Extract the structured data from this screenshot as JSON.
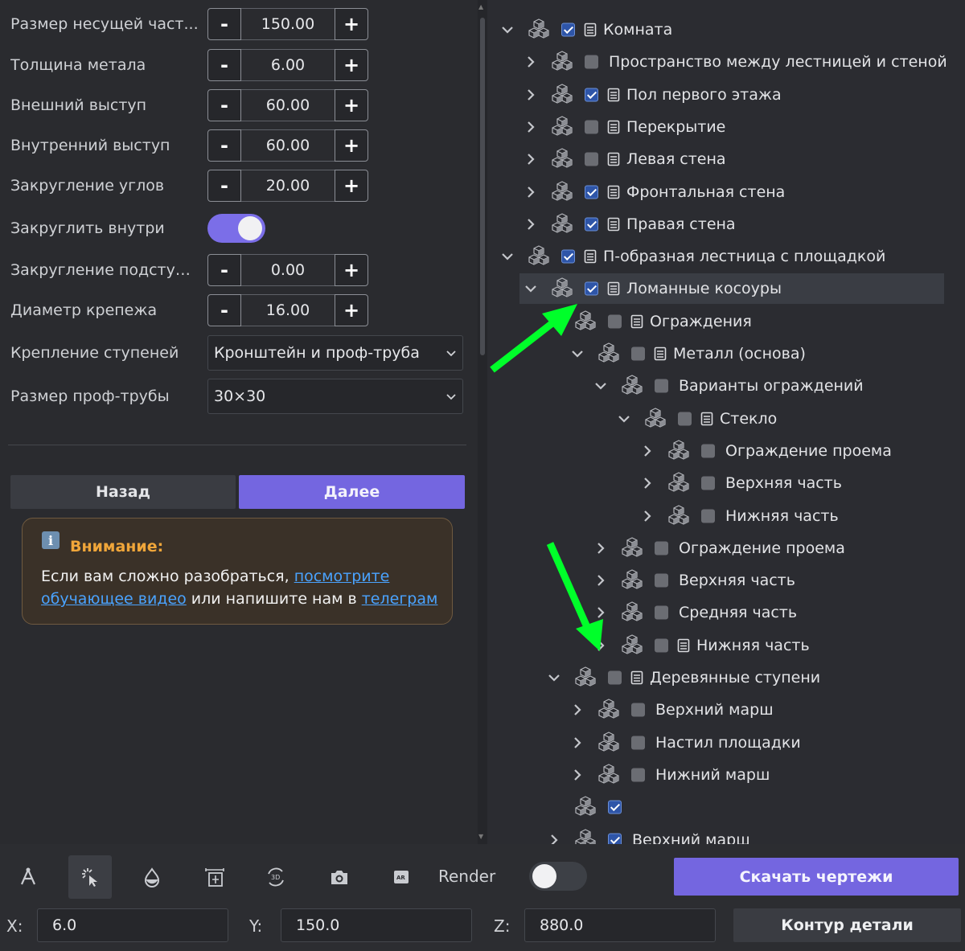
{
  "params": [
    {
      "label": "Размер несущей част...",
      "type": "stepper",
      "value": "150.00"
    },
    {
      "label": "Толщина метала",
      "type": "stepper",
      "value": "6.00"
    },
    {
      "label": "Внешний выступ",
      "type": "stepper",
      "value": "60.00"
    },
    {
      "label": "Внутренний выступ",
      "type": "stepper",
      "value": "60.00"
    },
    {
      "label": "Закругление углов",
      "type": "stepper",
      "value": "20.00"
    },
    {
      "label": "Закруглить внутри",
      "type": "toggle",
      "value": true
    },
    {
      "label": "Закругление подступе...",
      "type": "stepper",
      "value": "0.00"
    },
    {
      "label": "Диаметр крепежа",
      "type": "stepper",
      "value": "16.00"
    },
    {
      "label": "Крепление ступеней",
      "type": "select",
      "value": "Кронштейн и проф-труба"
    },
    {
      "label": "Размер проф-трубы",
      "type": "select",
      "value": "30×30"
    }
  ],
  "stepper": {
    "minus": "-",
    "plus": "+"
  },
  "nav": {
    "back": "Назад",
    "next": "Далее"
  },
  "notice": {
    "title": "Внимание:",
    "text_before": "Если вам сложно разобраться, ",
    "link1": "посмотрите обучающее видео",
    "text_middle": " или напишите нам в ",
    "link2": "телеграм"
  },
  "tree": [
    {
      "label": "Комната",
      "level": 0,
      "expanded": true,
      "checked": true,
      "doc": true,
      "chevron": true
    },
    {
      "label": "Пространство между лестницей и стеной",
      "level": 1,
      "expanded": false,
      "checked": false,
      "doc": false,
      "chevron": true
    },
    {
      "label": "Пол первого этажа",
      "level": 1,
      "expanded": false,
      "checked": true,
      "doc": true,
      "chevron": true
    },
    {
      "label": "Перекрытие",
      "level": 1,
      "expanded": false,
      "checked": false,
      "doc": true,
      "chevron": true
    },
    {
      "label": "Левая стена",
      "level": 1,
      "expanded": false,
      "checked": false,
      "doc": true,
      "chevron": true
    },
    {
      "label": "Фронтальная стена",
      "level": 1,
      "expanded": false,
      "checked": true,
      "doc": true,
      "chevron": true
    },
    {
      "label": "Правая стена",
      "level": 1,
      "expanded": false,
      "checked": true,
      "doc": true,
      "chevron": true
    },
    {
      "label": "П-образная лестница с площадкой",
      "level": 0,
      "expanded": true,
      "checked": true,
      "doc": true,
      "chevron": true
    },
    {
      "label": "Ломанные косоуры",
      "level": 1,
      "expanded": true,
      "checked": true,
      "doc": true,
      "chevron": true,
      "selected": true
    },
    {
      "label": "Ограждения",
      "level": 2,
      "expanded": true,
      "checked": false,
      "doc": true,
      "chevron": false
    },
    {
      "label": "Металл (основа)",
      "level": 3,
      "expanded": true,
      "checked": false,
      "doc": true,
      "chevron": true
    },
    {
      "label": "Варианты ограждений",
      "level": 4,
      "expanded": true,
      "checked": false,
      "doc": false,
      "chevron": true
    },
    {
      "label": "Стекло",
      "level": 5,
      "expanded": true,
      "checked": false,
      "doc": true,
      "chevron": true
    },
    {
      "label": "Ограждение проема",
      "level": 6,
      "expanded": false,
      "checked": false,
      "doc": false,
      "chevron": true
    },
    {
      "label": "Верхняя часть",
      "level": 6,
      "expanded": false,
      "checked": false,
      "doc": false,
      "chevron": true
    },
    {
      "label": "Нижняя часть",
      "level": 6,
      "expanded": false,
      "checked": false,
      "doc": false,
      "chevron": true
    },
    {
      "label": "Ограждение проема",
      "level": 4,
      "expanded": false,
      "checked": false,
      "doc": false,
      "chevron": true
    },
    {
      "label": "Верхняя часть",
      "level": 4,
      "expanded": false,
      "checked": false,
      "doc": false,
      "chevron": true
    },
    {
      "label": "Средняя часть",
      "level": 4,
      "expanded": false,
      "checked": false,
      "doc": false,
      "chevron": true
    },
    {
      "label": "Нижняя часть",
      "level": 4,
      "expanded": false,
      "checked": false,
      "doc": true,
      "chevron": true
    },
    {
      "label": "Деревянные ступени",
      "level": 2,
      "expanded": true,
      "checked": false,
      "doc": true,
      "chevron": true
    },
    {
      "label": "Верхний марш",
      "level": 3,
      "expanded": false,
      "checked": false,
      "doc": false,
      "chevron": true
    },
    {
      "label": "Настил площадки",
      "level": 3,
      "expanded": false,
      "checked": false,
      "doc": false,
      "chevron": true
    },
    {
      "label": "Нижний марш",
      "level": 3,
      "expanded": false,
      "checked": false,
      "doc": false,
      "chevron": true
    },
    {
      "label": "",
      "level": 2,
      "expanded": false,
      "checked": true,
      "doc": false,
      "chevron": false
    },
    {
      "label": "Верхний марш",
      "level": 2,
      "expanded": false,
      "checked": true,
      "doc": false,
      "chevron": true
    }
  ],
  "toolbar": {
    "icons": [
      "measure-icon",
      "select-icon",
      "fill-icon",
      "dimension-icon",
      "rotate-3d-icon",
      "camera-icon",
      "ar-icon"
    ],
    "render_label": "Render",
    "render_on": false,
    "download": "Скачать чертежи"
  },
  "coords": {
    "x_label": "X:",
    "x": "6.0",
    "y_label": "Y:",
    "y": "150.0",
    "z_label": "Z:",
    "z": "880.0"
  },
  "contour": "Контур детали",
  "colors": {
    "accent": "#7466e0",
    "highlight_arrow": "#00ff2a",
    "notice_title": "#f0a63a",
    "link": "#4aa3ff"
  }
}
